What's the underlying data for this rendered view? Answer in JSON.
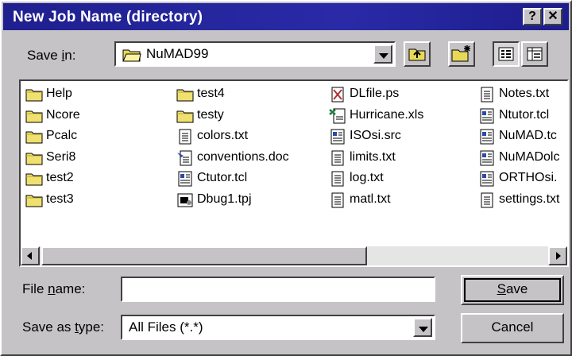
{
  "window": {
    "title": "New Job Name (directory)",
    "help_btn": "?",
    "close_btn": "✕"
  },
  "save_in": {
    "label_pre": "Save ",
    "label_u": "i",
    "label_post": "n:",
    "value": "NuMAD99"
  },
  "files": [
    {
      "name": "Help",
      "icon": "folder"
    },
    {
      "name": "Ncore",
      "icon": "folder"
    },
    {
      "name": "Pcalc",
      "icon": "folder"
    },
    {
      "name": "Seri8",
      "icon": "folder"
    },
    {
      "name": "test2",
      "icon": "folder"
    },
    {
      "name": "test3",
      "icon": "folder"
    },
    {
      "name": "test4",
      "icon": "folder"
    },
    {
      "name": "testy",
      "icon": "folder"
    },
    {
      "name": "colors.txt",
      "icon": "text"
    },
    {
      "name": "conventions.doc",
      "icon": "doc"
    },
    {
      "name": "Ctutor.tcl",
      "icon": "script"
    },
    {
      "name": "Dbug1.tpj",
      "icon": "project"
    },
    {
      "name": "DLfile.ps",
      "icon": "ps"
    },
    {
      "name": "Hurricane.xls",
      "icon": "xls"
    },
    {
      "name": "ISOsi.src",
      "icon": "script"
    },
    {
      "name": "limits.txt",
      "icon": "text"
    },
    {
      "name": "log.txt",
      "icon": "text"
    },
    {
      "name": "matl.txt",
      "icon": "text"
    },
    {
      "name": "Notes.txt",
      "icon": "text"
    },
    {
      "name": "Ntutor.tcl",
      "icon": "script"
    },
    {
      "name": "NuMAD.tc",
      "icon": "script"
    },
    {
      "name": "NuMADolc",
      "icon": "script"
    },
    {
      "name": "ORTHOsi.",
      "icon": "script"
    },
    {
      "name": "settings.txt",
      "icon": "text"
    }
  ],
  "file_name": {
    "label_pre": "File ",
    "label_u": "n",
    "label_post": "ame:",
    "value": ""
  },
  "save_type": {
    "label_pre": "Save as ",
    "label_u": "t",
    "label_post": "ype:",
    "value": "All Files (*.*)"
  },
  "buttons": {
    "save_u": "S",
    "save_rest": "ave",
    "cancel": "Cancel"
  }
}
